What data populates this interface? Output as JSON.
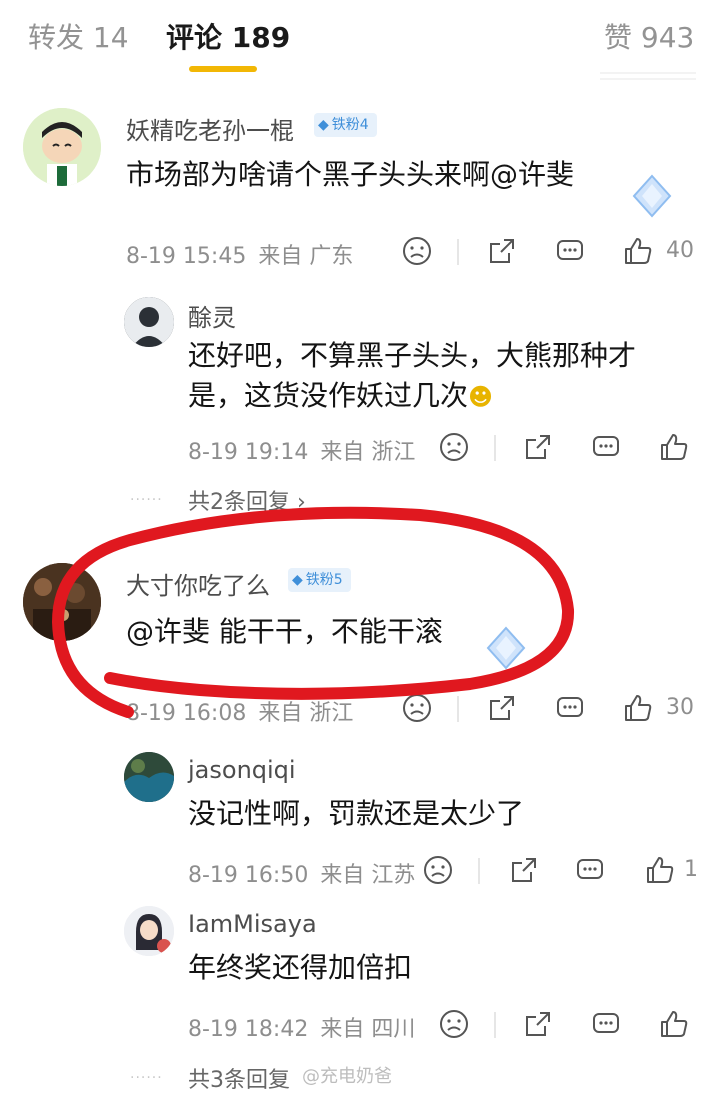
{
  "tabs": {
    "repost": "转发 14",
    "comments": "评论 189",
    "likes": "赞 943"
  },
  "watermark": "@充电奶爸",
  "colors": {
    "accent_underline": "#f2b705",
    "annotation_red": "#e0181f",
    "badge_blue": "#3f8fd9"
  },
  "comments": [
    {
      "user": "妖精吃老孙一棍",
      "badge": "铁粉4",
      "text": "市场部为啥请个黑子头头来啊@许斐",
      "date": "8-19 15:45",
      "location": "来自 广东",
      "likes": "40",
      "replies": [
        {
          "user": "酴灵",
          "text_line1": "还好吧，不算黑子头头，大熊那种才",
          "text_line2": "是，这货没作妖过几次",
          "date": "8-19 19:14",
          "location": "来自 浙江"
        }
      ],
      "more_replies": "共2条回复 ›"
    },
    {
      "user": "大寸你吃了么",
      "badge": "铁粉5",
      "text_mention": "@许斐",
      "text_rest": " 能干干，不能干滚",
      "date": "8-19 16:08",
      "location": "来自 浙江",
      "likes": "30",
      "replies": [
        {
          "user": "jasonqiqi",
          "text": "没记性啊，罚款还是太少了",
          "date": "8-19 16:50",
          "location": "来自 江苏",
          "likes": "1"
        },
        {
          "user": "IamMisaya",
          "text": "年终奖还得加倍扣",
          "date": "8-19 18:42",
          "location": "来自 四川"
        }
      ],
      "more_replies": "共3条回复"
    }
  ],
  "icons": [
    "sad-face-icon",
    "share-icon",
    "comment-icon",
    "thumbs-up-icon",
    "diamond-icon"
  ]
}
